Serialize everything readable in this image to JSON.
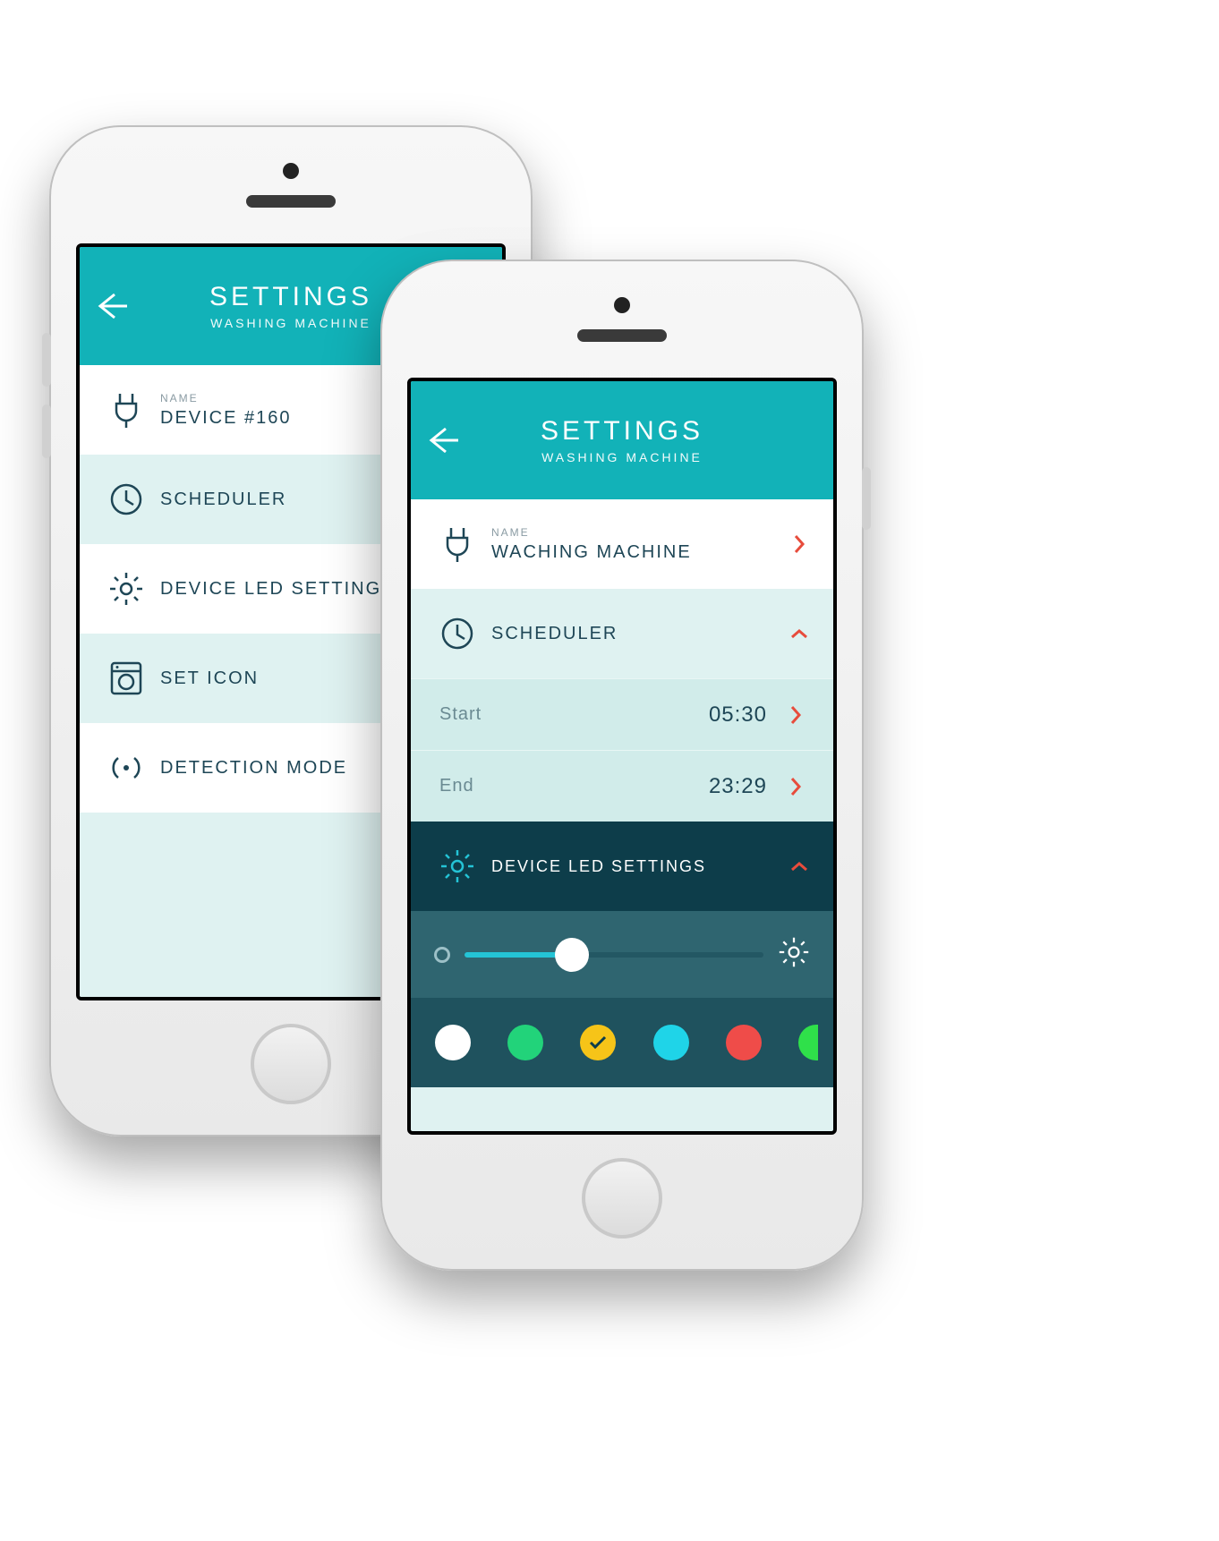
{
  "header": {
    "title": "SETTINGS",
    "subtitle": "WASHING MACHINE"
  },
  "p1": {
    "name_label": "NAME",
    "name_value": "DEVICE #160",
    "scheduler": "SCHEDULER",
    "led": "DEVICE LED SETTINGS",
    "seticon": "SET ICON",
    "detection": "DETECTION MODE"
  },
  "p2": {
    "name_label": "NAME",
    "name_value": "WACHING MACHINE",
    "scheduler": "SCHEDULER",
    "start_label": "Start",
    "start_value": "05:30",
    "end_label": "End",
    "end_value": "23:29",
    "led": "DEVICE LED SETTINGS",
    "slider_percent": 36,
    "colors": [
      {
        "name": "white",
        "hex": "#ffffff",
        "selected": false
      },
      {
        "name": "green",
        "hex": "#22d37a",
        "selected": false
      },
      {
        "name": "yellow",
        "hex": "#f6c418",
        "selected": true
      },
      {
        "name": "cyan",
        "hex": "#1fd4e8",
        "selected": false
      },
      {
        "name": "red",
        "hex": "#ef4c49",
        "selected": false
      },
      {
        "name": "lime",
        "hex": "#2fe04a",
        "selected": false,
        "partial": true
      }
    ]
  }
}
